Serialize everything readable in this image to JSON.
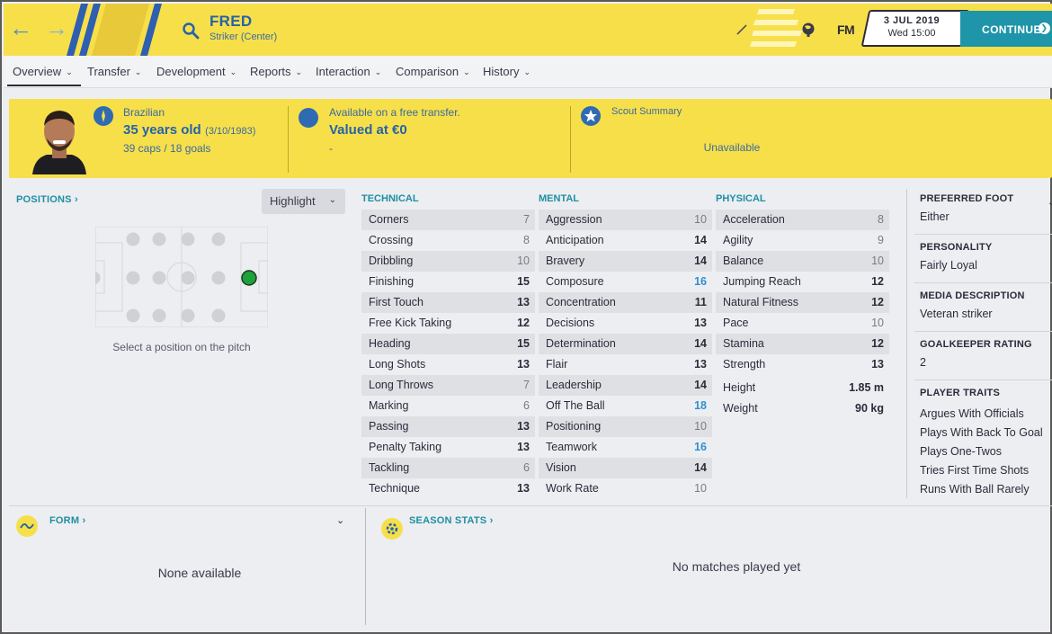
{
  "header": {
    "player_name": "FRED",
    "player_role": "Striker (Center)",
    "fm_logo": "FM",
    "date": "3 JUL 2019",
    "day_time": "Wed 15:00",
    "continue_label": "CONTINUE",
    "icons": [
      "back-arrow-icon",
      "forward-arrow-icon",
      "search-icon",
      "pencil-icon",
      "globe-icon",
      "chevron-right-icon"
    ]
  },
  "tabs": [
    {
      "label": "Overview",
      "active": true
    },
    {
      "label": "Transfer"
    },
    {
      "label": "Development"
    },
    {
      "label": "Reports"
    },
    {
      "label": "Interaction"
    },
    {
      "label": "Comparison"
    },
    {
      "label": "History"
    }
  ],
  "info": {
    "nationality": "Brazilian",
    "age": "35 years old",
    "dob": "(3/10/1983)",
    "caps": "39 caps / 18 goals",
    "transfer_status": "Available on a free transfer.",
    "value": "Valued at €0",
    "value_sub": "-",
    "scout_title": "Scout Summary",
    "scout_value": "Unavailable"
  },
  "positions": {
    "title": "POSITIONS",
    "highlight_label": "Highlight",
    "caption": "Select a position on the pitch"
  },
  "technical": {
    "title": "TECHNICAL",
    "rows": [
      {
        "name": "Corners",
        "value": "7"
      },
      {
        "name": "Crossing",
        "value": "8"
      },
      {
        "name": "Dribbling",
        "value": "10"
      },
      {
        "name": "Finishing",
        "value": "15"
      },
      {
        "name": "First Touch",
        "value": "13"
      },
      {
        "name": "Free Kick Taking",
        "value": "12"
      },
      {
        "name": "Heading",
        "value": "15"
      },
      {
        "name": "Long Shots",
        "value": "13"
      },
      {
        "name": "Long Throws",
        "value": "7"
      },
      {
        "name": "Marking",
        "value": "6"
      },
      {
        "name": "Passing",
        "value": "13"
      },
      {
        "name": "Penalty Taking",
        "value": "13"
      },
      {
        "name": "Tackling",
        "value": "6"
      },
      {
        "name": "Technique",
        "value": "13"
      }
    ]
  },
  "mental": {
    "title": "MENTAL",
    "rows": [
      {
        "name": "Aggression",
        "value": "10"
      },
      {
        "name": "Anticipation",
        "value": "14"
      },
      {
        "name": "Bravery",
        "value": "14"
      },
      {
        "name": "Composure",
        "value": "16"
      },
      {
        "name": "Concentration",
        "value": "11"
      },
      {
        "name": "Decisions",
        "value": "13"
      },
      {
        "name": "Determination",
        "value": "14"
      },
      {
        "name": "Flair",
        "value": "13"
      },
      {
        "name": "Leadership",
        "value": "14"
      },
      {
        "name": "Off The Ball",
        "value": "18"
      },
      {
        "name": "Positioning",
        "value": "10"
      },
      {
        "name": "Teamwork",
        "value": "16"
      },
      {
        "name": "Vision",
        "value": "14"
      },
      {
        "name": "Work Rate",
        "value": "10"
      }
    ]
  },
  "physical": {
    "title": "PHYSICAL",
    "rows": [
      {
        "name": "Acceleration",
        "value": "8"
      },
      {
        "name": "Agility",
        "value": "9"
      },
      {
        "name": "Balance",
        "value": "10"
      },
      {
        "name": "Jumping Reach",
        "value": "12"
      },
      {
        "name": "Natural Fitness",
        "value": "12"
      },
      {
        "name": "Pace",
        "value": "10"
      },
      {
        "name": "Stamina",
        "value": "12"
      },
      {
        "name": "Strength",
        "value": "13"
      }
    ],
    "height_label": "Height",
    "height_value": "1.85 m",
    "weight_label": "Weight",
    "weight_value": "90 kg"
  },
  "sidebar": {
    "preferred_foot_title": "PREFERRED FOOT",
    "preferred_foot": "Either",
    "personality_title": "PERSONALITY",
    "personality": "Fairly Loyal",
    "media_title": "MEDIA DESCRIPTION",
    "media": "Veteran striker",
    "gk_title": "GOALKEEPER RATING",
    "gk": "2",
    "traits_title": "PLAYER TRAITS",
    "traits": [
      "Argues With Officials",
      "Plays With Back To Goal",
      "Plays One-Twos",
      "Tries First Time Shots",
      "Runs With Ball Rarely"
    ]
  },
  "form": {
    "title": "FORM",
    "empty": "None available"
  },
  "season": {
    "title": "SEASON STATS",
    "empty": "No matches played yet"
  },
  "colors": {
    "accent_yellow": "#f7df4a",
    "accent_blue": "#2563a8",
    "teal": "#1f8fa3",
    "highlight_value": "#2f8fd1",
    "position_green": "#1ea13a"
  }
}
